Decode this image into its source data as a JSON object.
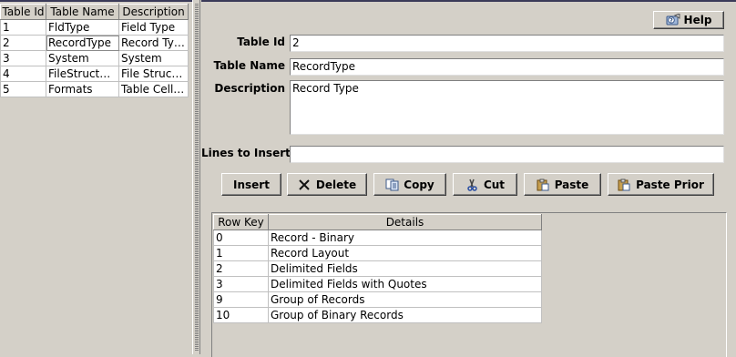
{
  "left_table": {
    "headers": [
      "Table Id",
      "Table Name",
      "Description"
    ],
    "rows": [
      [
        "1",
        "FldType",
        "Field Type"
      ],
      [
        "2",
        "RecordType",
        "Record Type"
      ],
      [
        "3",
        "System",
        "System"
      ],
      [
        "4",
        "FileStructure",
        "File Structu..."
      ],
      [
        "5",
        "Formats",
        "Table Cell ..."
      ]
    ]
  },
  "help_button": {
    "label": "Help",
    "icon": "help-icon"
  },
  "form": {
    "table_id_label": "Table Id",
    "table_id_value": "2",
    "table_name_label": "Table Name",
    "table_name_value": "RecordType",
    "description_label": "Description",
    "description_value": "Record Type",
    "lines_label": "Lines to Insert",
    "lines_value": ""
  },
  "toolbar": {
    "insert_label": "Insert",
    "delete_label": "Delete",
    "copy_label": "Copy",
    "cut_label": "Cut",
    "paste_label": "Paste",
    "paste_prior_label": "Paste Prior"
  },
  "details_table": {
    "headers": [
      "Row Key",
      "Details"
    ],
    "rows": [
      [
        "0",
        "Record - Binary"
      ],
      [
        "1",
        "Record Layout"
      ],
      [
        "2",
        "Delimited Fields"
      ],
      [
        "3",
        "Delimited Fields with Quotes"
      ],
      [
        "9",
        "Group of Records"
      ],
      [
        "10",
        "Group of Binary Records"
      ]
    ]
  },
  "colors": {
    "background": "#d4d0c8",
    "title_bar_edge": "#3a3a58"
  }
}
